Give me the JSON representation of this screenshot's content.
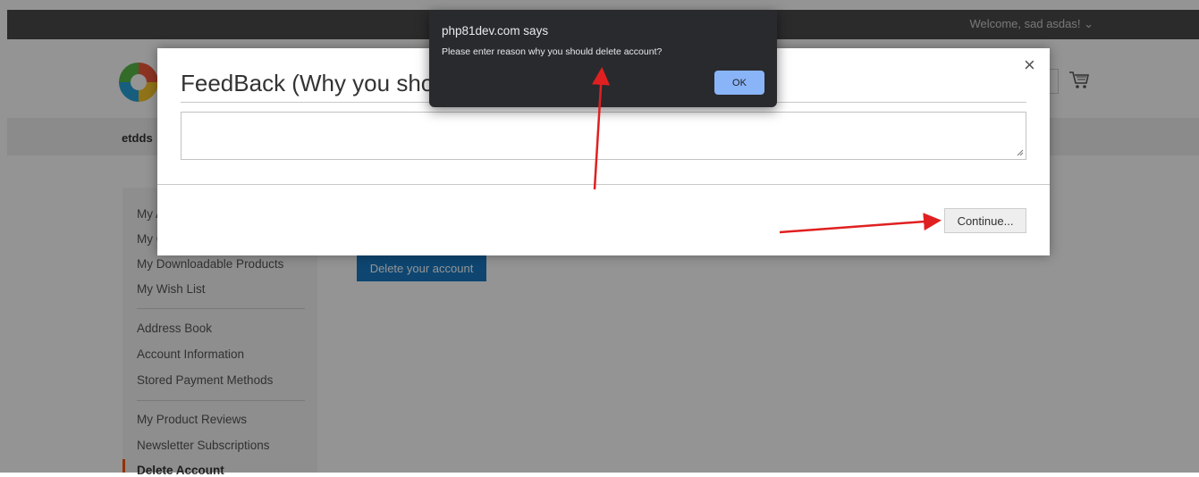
{
  "header": {
    "welcome": "Welcome, sad asdas! ⌄",
    "nav_label": "etdds"
  },
  "sidebar": {
    "items": [
      {
        "label": "My Account"
      },
      {
        "label": "My Orders"
      },
      {
        "label": "My Downloadable Products"
      },
      {
        "label": "My Wish List"
      },
      {
        "label": "Address Book"
      },
      {
        "label": "Account Information"
      },
      {
        "label": "Stored Payment Methods"
      },
      {
        "label": "My Product Reviews"
      },
      {
        "label": "Newsletter Subscriptions"
      },
      {
        "label": "Delete Account"
      }
    ]
  },
  "main": {
    "delete_button": "Delete your account"
  },
  "modal": {
    "title": "FeedBack (Why you should d",
    "close": "×",
    "feedback_value": "",
    "continue_button": "Continue..."
  },
  "alert": {
    "title": "php81dev.com says",
    "message": "Please enter reason why you should delete account?",
    "ok_button": "OK"
  },
  "colors": {
    "accent": "#1979c3",
    "alert_button": "#8ab4f8",
    "annotation_arrow": "#e02020",
    "active_marker": "#ff5501"
  },
  "icons": {
    "cart": "cart-icon",
    "close": "close-icon",
    "logo": "logo-icon"
  }
}
